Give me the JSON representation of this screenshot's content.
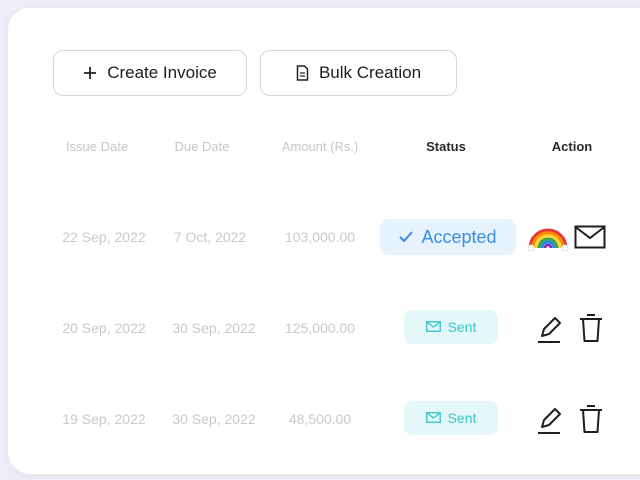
{
  "toolbar": {
    "create_label": "Create Invoice",
    "bulk_label": "Bulk Creation"
  },
  "table": {
    "headers": {
      "issue_date": "Issue Date",
      "due_date": "Due Date",
      "amount": "Amount (Rs.)",
      "status": "Status",
      "action": "Action"
    },
    "rows": [
      {
        "issue_date": "22 Sep, 2022",
        "due_date": "7 Oct, 2022",
        "amount": "103,000.00",
        "status": "Accepted",
        "actions": [
          "rainbow-icon",
          "mail-icon"
        ]
      },
      {
        "issue_date": "20 Sep, 2022",
        "due_date": "30 Sep, 2022",
        "amount": "125,000.00",
        "status": "Sent",
        "actions": [
          "edit-icon",
          "delete-icon"
        ]
      },
      {
        "issue_date": "19 Sep, 2022",
        "due_date": "30 Sep, 2022",
        "amount": "48,500.00",
        "status": "Sent",
        "actions": [
          "edit-icon",
          "delete-icon"
        ]
      }
    ]
  },
  "colors": {
    "accepted_bg": "#e6f2fc",
    "accepted_text": "#3a8ee6",
    "sent_bg": "#e4f8f9",
    "sent_text": "#3bc5d0"
  }
}
